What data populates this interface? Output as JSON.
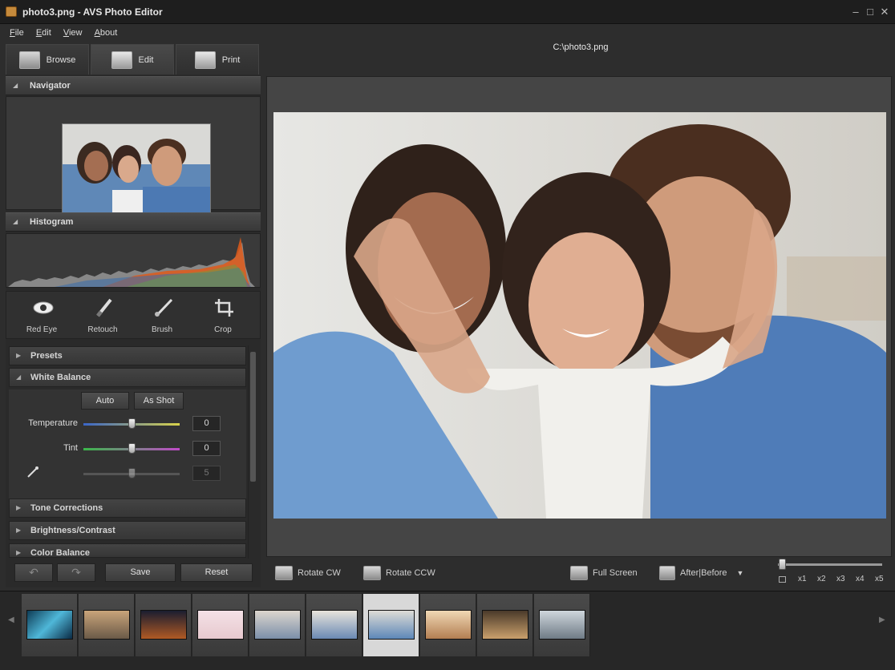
{
  "window": {
    "title": "photo3.png  -  AVS Photo Editor"
  },
  "menu": [
    {
      "label": "File",
      "key": "F",
      "rest": "ile"
    },
    {
      "label": "Edit",
      "key": "E",
      "rest": "dit"
    },
    {
      "label": "View",
      "key": "V",
      "rest": "iew"
    },
    {
      "label": "About",
      "key": "A",
      "rest": "bout"
    }
  ],
  "tabs": {
    "browse": "Browse",
    "edit": "Edit",
    "print": "Print"
  },
  "filepath": "C:\\photo3.png",
  "panels": {
    "navigator": "Navigator",
    "histogram": "Histogram"
  },
  "tools": {
    "red_eye": "Red Eye",
    "retouch": "Retouch",
    "brush": "Brush",
    "crop": "Crop"
  },
  "sections": {
    "presets": "Presets",
    "white_balance": "White Balance",
    "tone_corrections": "Tone Corrections",
    "brightness_contrast": "Brightness/Contrast",
    "color_balance": "Color Balance"
  },
  "white_balance": {
    "auto": "Auto",
    "as_shot": "As Shot",
    "temperature_label": "Temperature",
    "temperature_value": "0",
    "tint_label": "Tint",
    "tint_value": "0",
    "picker_value": "5"
  },
  "bottom_buttons": {
    "save": "Save",
    "reset": "Reset"
  },
  "main_toolbar": {
    "rotate_cw": "Rotate CW",
    "rotate_ccw": "Rotate CCW",
    "full_screen": "Full Screen",
    "after_before": "After|Before"
  },
  "zoom": {
    "labels": [
      "x1",
      "x2",
      "x3",
      "x4",
      "x5"
    ]
  },
  "colors": {
    "accent_bg": "#2d2d2d",
    "histogram_peak": "#e05a1a"
  }
}
